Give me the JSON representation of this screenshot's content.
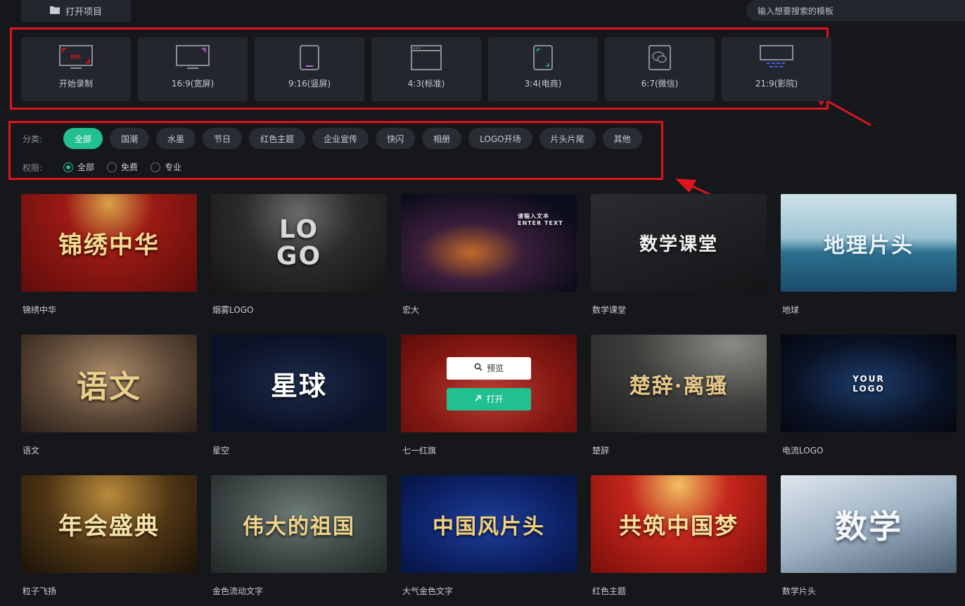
{
  "topbar": {
    "open_project": "打开项目",
    "search_placeholder": "输入想要搜索的模板"
  },
  "ratios": [
    {
      "label": "开始录制",
      "icon": "record-icon",
      "badge": "REC"
    },
    {
      "label": "16:9(宽屏)",
      "icon": "widescreen-icon"
    },
    {
      "label": "9:16(竖屏)",
      "icon": "portrait-icon"
    },
    {
      "label": "4:3(标准)",
      "icon": "standard-icon"
    },
    {
      "label": "3:4(电商)",
      "icon": "ecommerce-icon"
    },
    {
      "label": "6:7(微信)",
      "icon": "wechat-icon"
    },
    {
      "label": "21:9(影院)",
      "icon": "cinema-icon"
    }
  ],
  "filters": {
    "category_label": "分类:",
    "categories": [
      "全部",
      "国潮",
      "水墨",
      "节日",
      "红色主题",
      "企业宣传",
      "快闪",
      "相册",
      "LOGO开场",
      "片头片尾",
      "其他"
    ],
    "active_category": "全部",
    "permission_label": "权限:",
    "permissions": [
      "全部",
      "免费",
      "专业"
    ],
    "active_permission": "全部"
  },
  "templates": [
    {
      "name": "锦绣中华",
      "thumb_text": "锦绣中华"
    },
    {
      "name": "烟雾LOGO",
      "thumb_text": "LO GO"
    },
    {
      "name": "宏大",
      "thumb_text": "请输入文本 ENTER TEXT"
    },
    {
      "name": "数学课堂",
      "thumb_text": "数学课堂"
    },
    {
      "name": "地球",
      "thumb_text": "地理片头"
    },
    {
      "name": "语文",
      "thumb_text": "语文"
    },
    {
      "name": "星空",
      "thumb_text": "星球"
    },
    {
      "name": "七一红旗",
      "thumb_text": ""
    },
    {
      "name": "楚辞",
      "thumb_text": "楚辞·离骚"
    },
    {
      "name": "电流LOGO",
      "thumb_text": "YOUR LOGO"
    },
    {
      "name": "粒子飞扬",
      "thumb_text": "年会盛典"
    },
    {
      "name": "金色流动文字",
      "thumb_text": "伟大的祖国"
    },
    {
      "name": "大气金色文字",
      "thumb_text": "中国风片头"
    },
    {
      "name": "红色主题",
      "thumb_text": "共筑中国梦"
    },
    {
      "name": "数学片头",
      "thumb_text": "数学"
    }
  ],
  "hover": {
    "preview_label": "预览",
    "open_label": "打开"
  },
  "colors": {
    "accent": "#22c08f",
    "annotation": "#e0141e"
  }
}
